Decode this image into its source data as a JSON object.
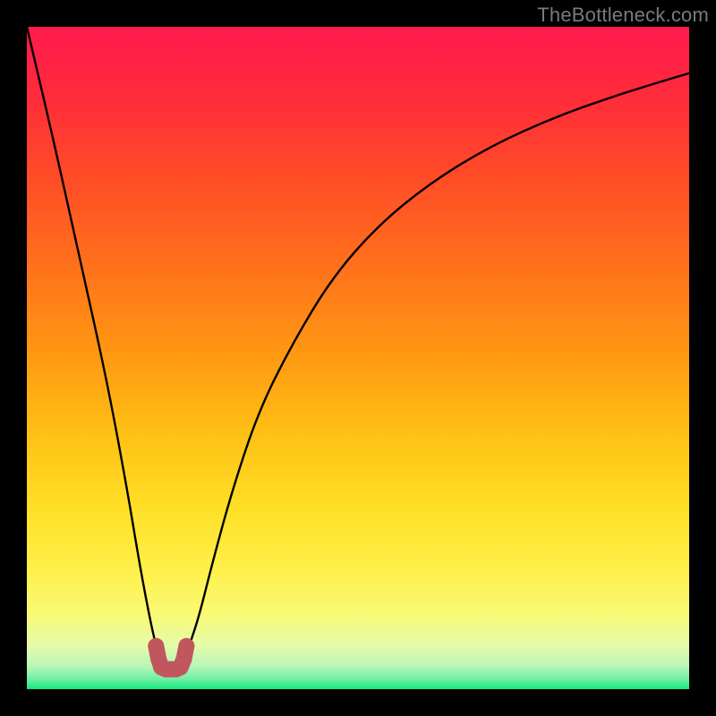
{
  "watermark": "TheBottleneck.com",
  "chart_data": {
    "type": "line",
    "title": "",
    "xlabel": "",
    "ylabel": "",
    "xlim": [
      0,
      100
    ],
    "ylim": [
      0,
      100
    ],
    "x": [
      0,
      4,
      8,
      12,
      15,
      17,
      18.5,
      19.5,
      20.5,
      21.5,
      23.5,
      24.5,
      26,
      28,
      31,
      35,
      40,
      46,
      53,
      61,
      70,
      80,
      90,
      100
    ],
    "values": [
      100,
      83,
      65,
      47,
      31,
      19,
      11,
      6.5,
      3,
      3,
      3,
      6.5,
      11,
      19,
      30,
      42,
      52,
      62,
      70,
      76.5,
      82,
      86.5,
      90,
      93
    ],
    "background_gradient_stops": [
      {
        "offset": 0.0,
        "color": "#ff1a4f"
      },
      {
        "offset": 0.1,
        "color": "#ff2a3c"
      },
      {
        "offset": 0.22,
        "color": "#ff4a28"
      },
      {
        "offset": 0.35,
        "color": "#ff6e1c"
      },
      {
        "offset": 0.5,
        "color": "#ff9a12"
      },
      {
        "offset": 0.62,
        "color": "#ffc215"
      },
      {
        "offset": 0.73,
        "color": "#ffe028"
      },
      {
        "offset": 0.82,
        "color": "#fff04a"
      },
      {
        "offset": 0.89,
        "color": "#f8fa78"
      },
      {
        "offset": 0.935,
        "color": "#e4fbaa"
      },
      {
        "offset": 0.965,
        "color": "#baf7b7"
      },
      {
        "offset": 0.985,
        "color": "#6ef0a4"
      },
      {
        "offset": 1.0,
        "color": "#17e87f"
      }
    ],
    "marker_cluster": {
      "color": "#c0575f",
      "points": [
        {
          "x": 19.5,
          "y": 6.5
        },
        {
          "x": 19.9,
          "y": 4.5
        },
        {
          "x": 20.3,
          "y": 3.3
        },
        {
          "x": 21.0,
          "y": 3.0
        },
        {
          "x": 21.8,
          "y": 3.0
        },
        {
          "x": 22.5,
          "y": 3.0
        },
        {
          "x": 23.2,
          "y": 3.3
        },
        {
          "x": 23.7,
          "y": 4.5
        },
        {
          "x": 24.1,
          "y": 6.5
        }
      ]
    }
  }
}
